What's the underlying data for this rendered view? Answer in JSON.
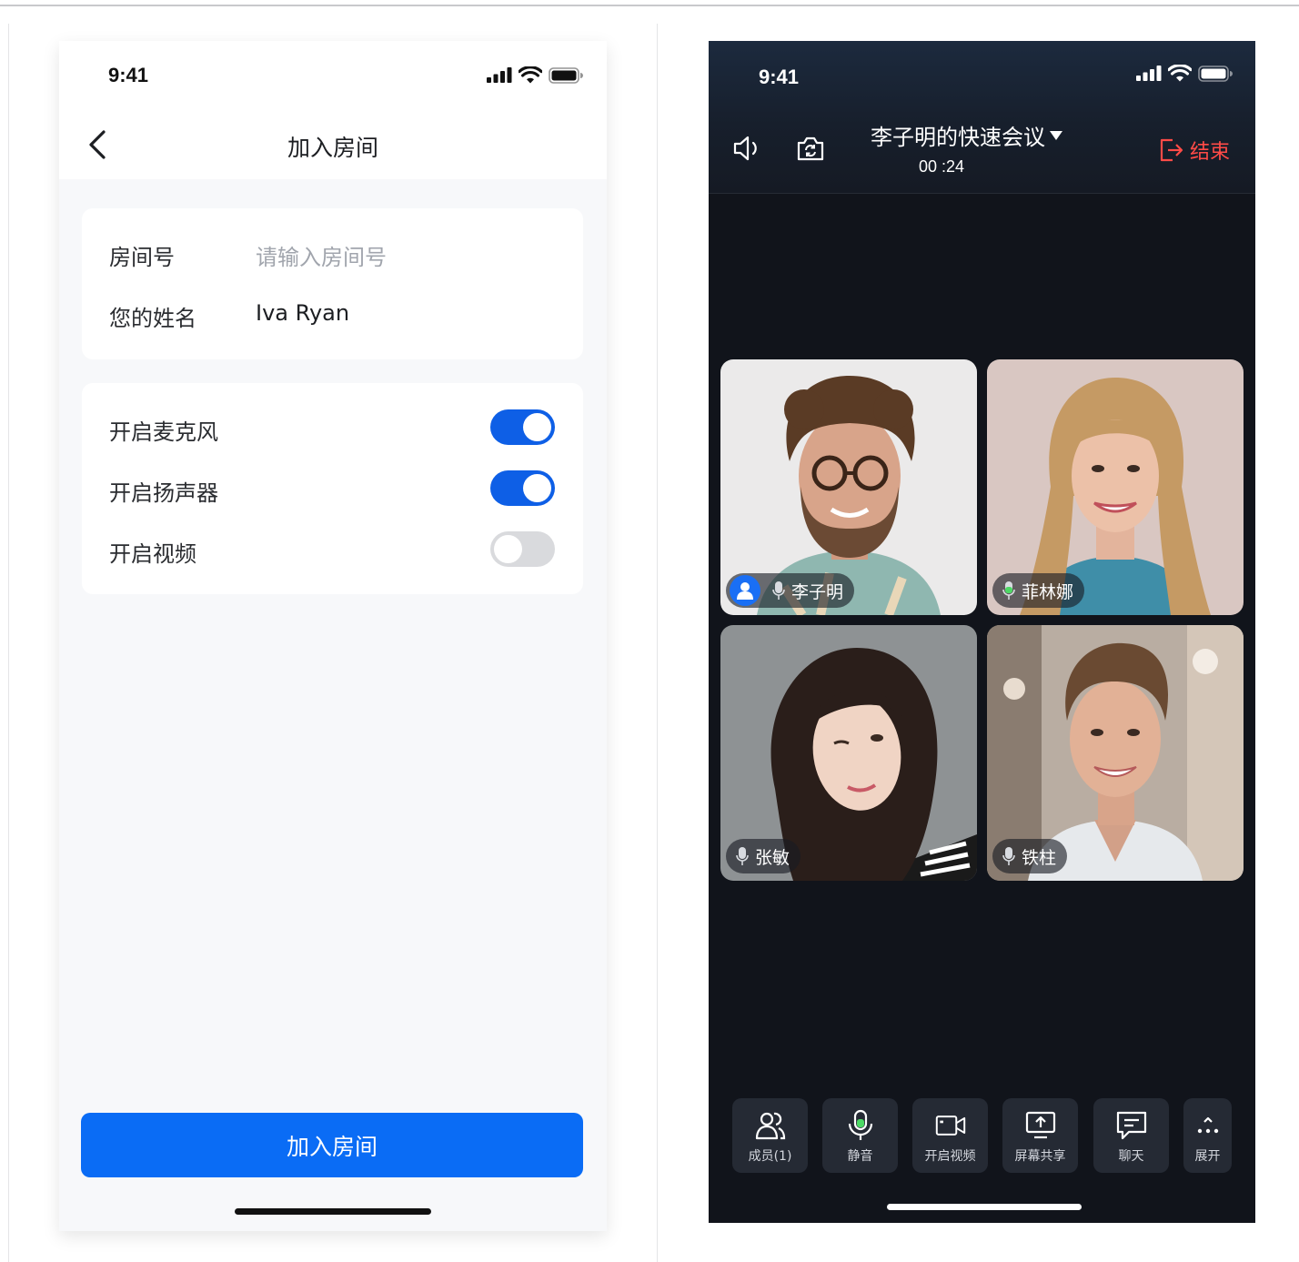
{
  "join_screen": {
    "status_time": "9:41",
    "title": "加入房间",
    "room_id": {
      "label": "房间号",
      "placeholder": "请输入房间号",
      "value": ""
    },
    "user_name": {
      "label": "您的姓名",
      "value": "Iva Ryan"
    },
    "toggles": [
      {
        "label": "开启麦克风",
        "on": true
      },
      {
        "label": "开启扬声器",
        "on": true
      },
      {
        "label": "开启视频",
        "on": false
      }
    ],
    "join_button": "加入房间"
  },
  "meeting_screen": {
    "status_time": "9:41",
    "meeting_title": "李子明的快速会议",
    "duration": "00 :24",
    "end_label": "结束",
    "participants": [
      {
        "name": "李子明",
        "is_host": true,
        "mic_active": false
      },
      {
        "name": "菲林娜",
        "is_host": false,
        "mic_active": true
      },
      {
        "name": "张敏",
        "is_host": false,
        "mic_active": false
      },
      {
        "name": "铁柱",
        "is_host": false,
        "mic_active": false
      }
    ],
    "toolbar": {
      "members": "成员(1)",
      "mute": "静音",
      "video": "开启视频",
      "screen_share": "屏幕共享",
      "chat": "聊天",
      "more": "展开"
    },
    "colors": {
      "accent": "#0a6cf5",
      "end": "#ff4b47",
      "mic_active": "#4cd964"
    }
  }
}
